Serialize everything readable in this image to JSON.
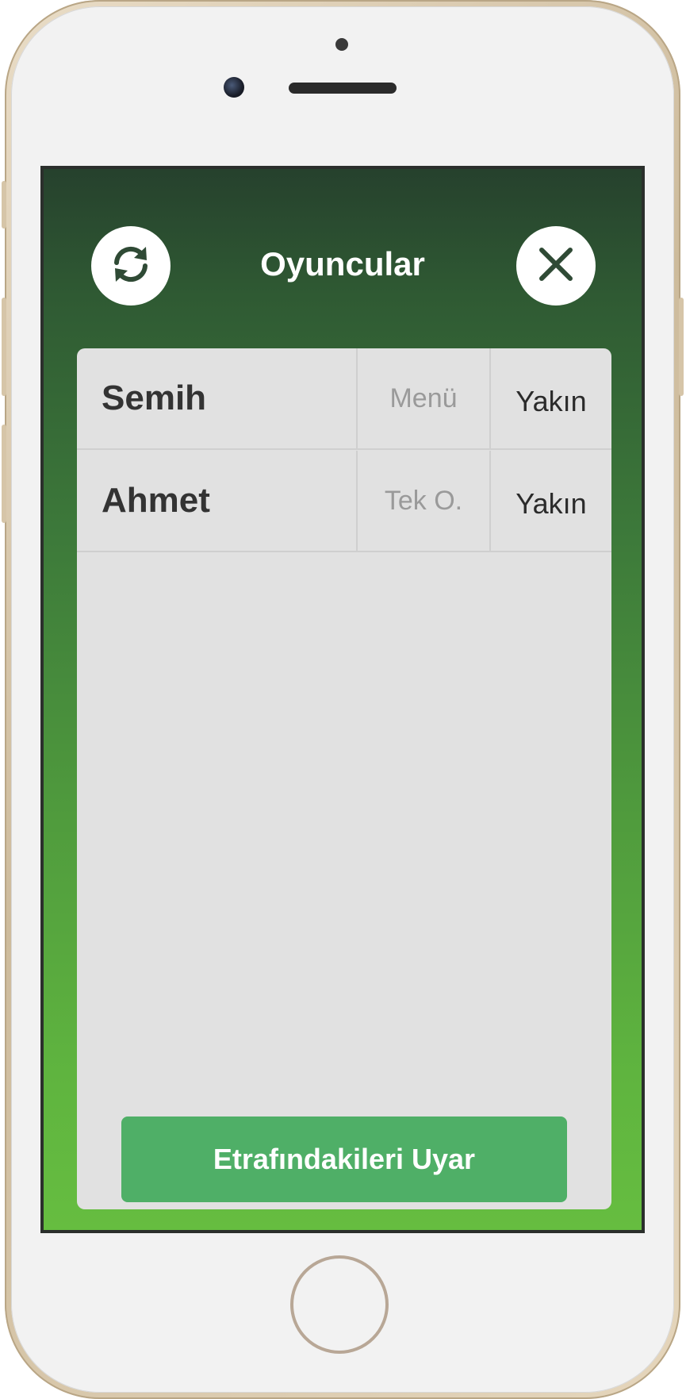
{
  "header": {
    "title": "Oyuncular",
    "refresh_icon": "refresh-icon",
    "close_icon": "close-icon"
  },
  "players": [
    {
      "name": "Semih",
      "status": "Menü",
      "action": "Yakın"
    },
    {
      "name": "Ahmet",
      "status": "Tek O.",
      "action": "Yakın"
    }
  ],
  "footer": {
    "warn_button_label": "Etrafındakileri Uyar"
  },
  "colors": {
    "accent_green": "#4faf67",
    "background_top": "#26412d",
    "background_bottom": "#66bd40"
  }
}
